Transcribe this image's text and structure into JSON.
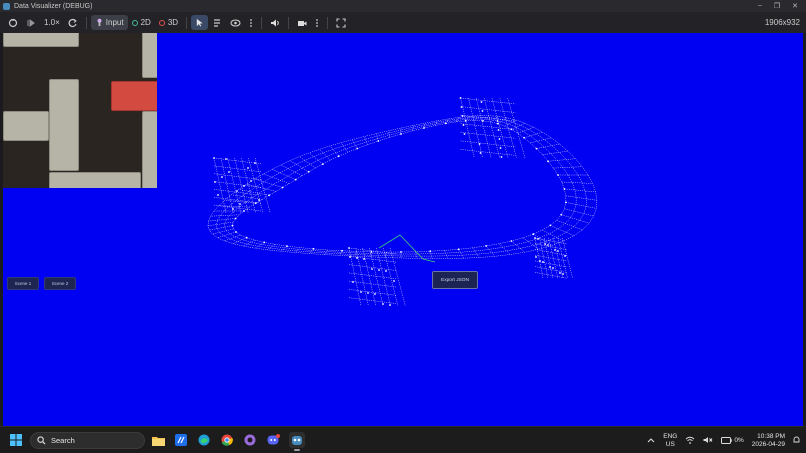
{
  "window": {
    "title": "Data Visualizer (DEBUG)",
    "minimize": "–",
    "restore": "❐",
    "close": "✕"
  },
  "toolbar": {
    "speed": "1.0×",
    "input_label": "Input",
    "mode_2d_label": "2D",
    "mode_3d_label": "3D",
    "resolution": "1906x932"
  },
  "viewport": {
    "background_color": "#0000f2",
    "scene_buttons": [
      "Scene 1",
      "Scene 2"
    ],
    "export_button": "Export JSON"
  },
  "taskbar": {
    "search_placeholder": "Search",
    "lang_top": "ENG",
    "lang_bottom": "US",
    "battery": "0%",
    "time": "10:38 PM",
    "date": "2026-04-29"
  },
  "colors": {
    "accent": "#478cbf",
    "mode_2d": "#3fbf8f",
    "mode_3d": "#e0524a",
    "wire": "#ffffff",
    "highlight_edge": "#3ad07a"
  }
}
